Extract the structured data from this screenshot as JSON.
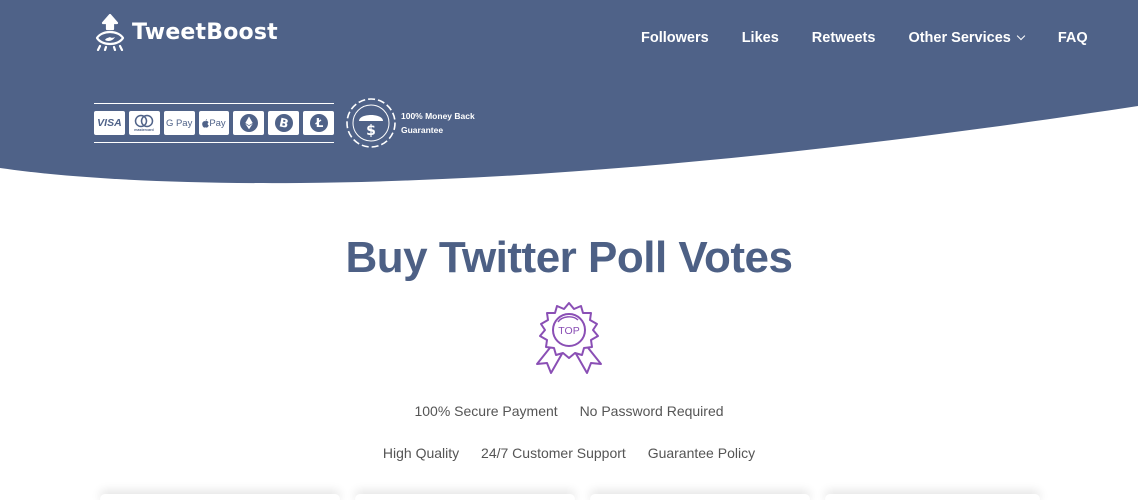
{
  "brand": {
    "name": "TweetBoost",
    "colors": {
      "header_bg": "#4f6288",
      "title": "#4d6085",
      "badge": "#8a4fb5",
      "text": "#555555"
    }
  },
  "nav": {
    "items": [
      {
        "label": "Followers"
      },
      {
        "label": "Likes"
      },
      {
        "label": "Retweets"
      },
      {
        "label": "Other Services",
        "has_dropdown": true
      },
      {
        "label": "FAQ"
      }
    ]
  },
  "payments": {
    "methods": [
      {
        "label": "VISA",
        "icon": "visa-icon"
      },
      {
        "label": "mastercard",
        "icon": "mastercard-icon"
      },
      {
        "label": "G Pay",
        "icon": "google-pay-icon"
      },
      {
        "label": "Pay",
        "icon": "apple-pay-icon"
      },
      {
        "label": "",
        "icon": "ethereum-icon"
      },
      {
        "label": "",
        "icon": "bitcoin-icon"
      },
      {
        "label": "",
        "icon": "litecoin-icon"
      }
    ],
    "guarantee_line1": "100% Money Back",
    "guarantee_line2": "Guarantee"
  },
  "main": {
    "title": "Buy Twitter Poll Votes",
    "badge_label": "TOP",
    "features_row1": [
      "100% Secure Payment",
      "No Password Required"
    ],
    "features_row2": [
      "High Quality",
      "24/7 Customer Support",
      "Guarantee Policy"
    ]
  }
}
